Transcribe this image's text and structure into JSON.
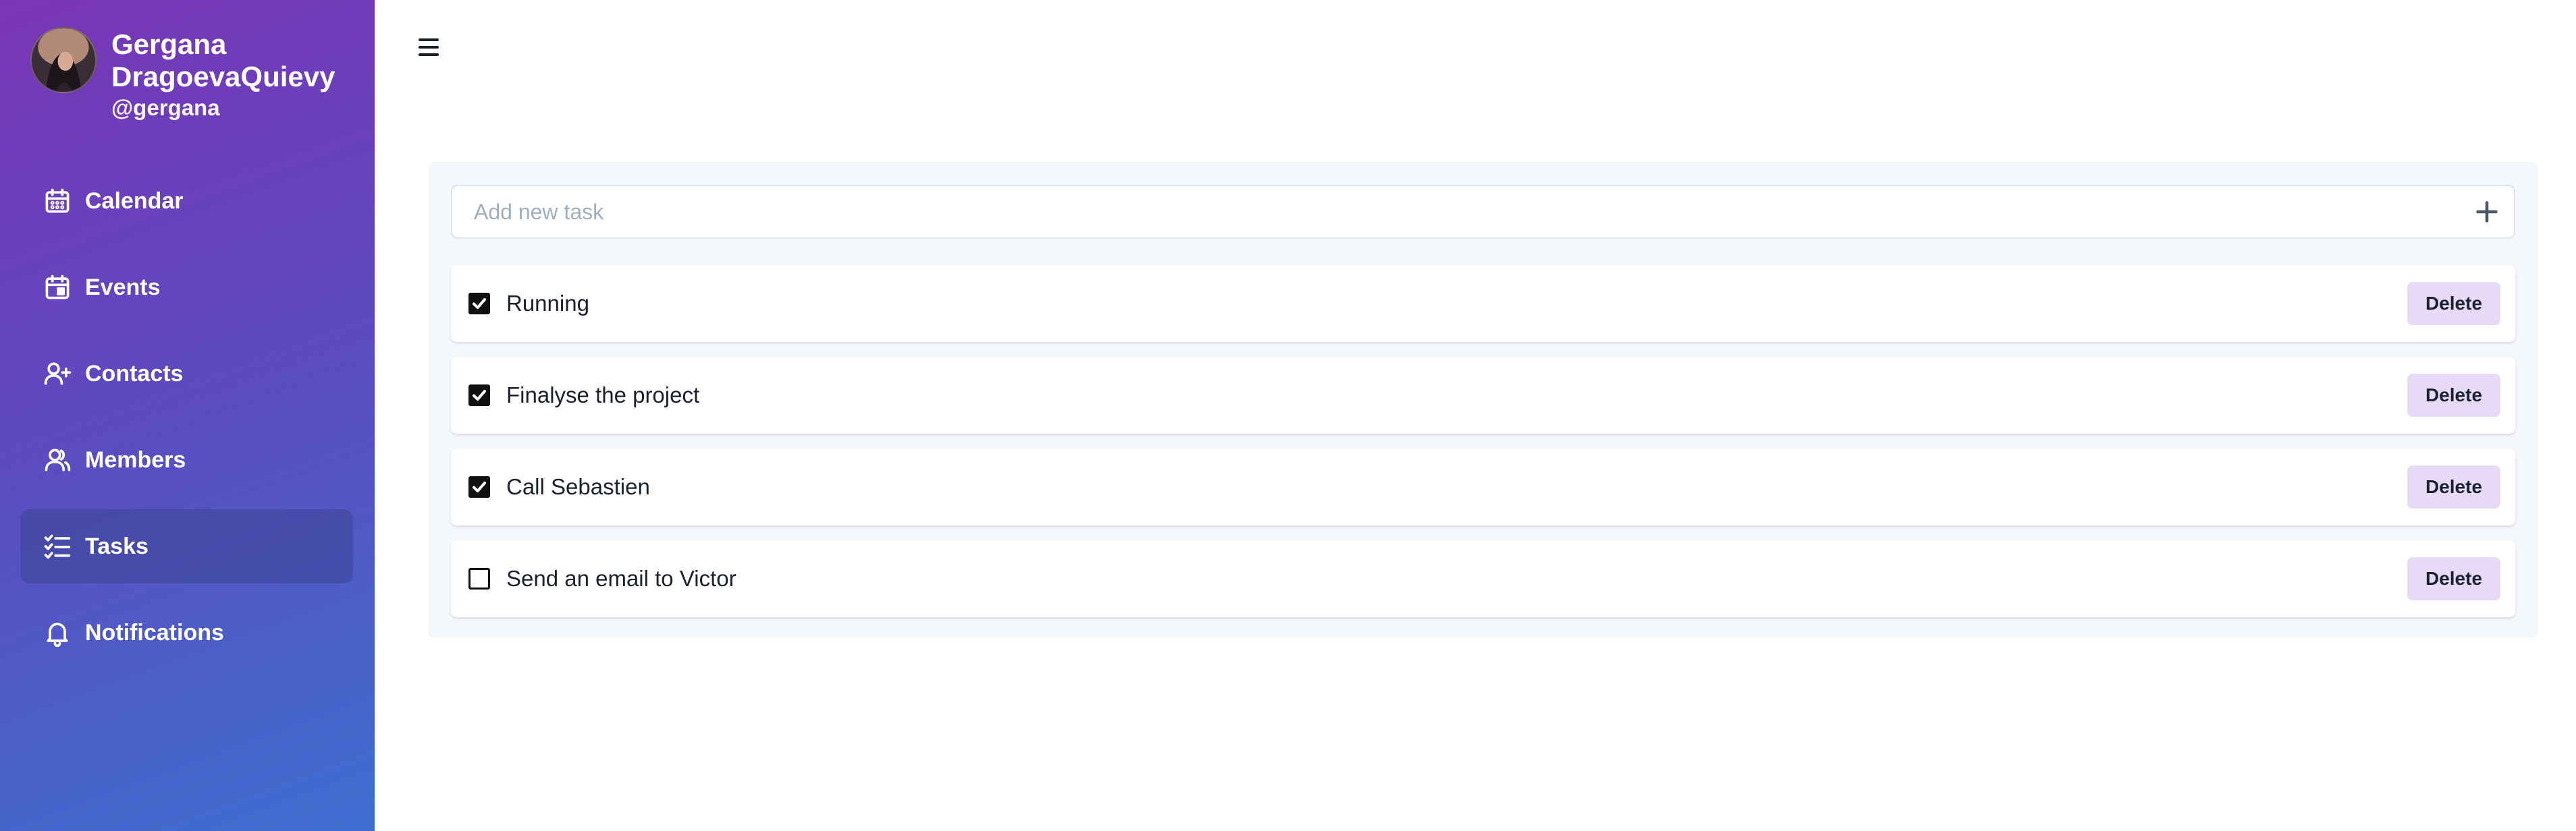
{
  "user": {
    "name": "Gergana DragoevaQuievy",
    "handle": "@gergana"
  },
  "nav": {
    "items": [
      {
        "label": "Calendar",
        "icon": "calendar-icon"
      },
      {
        "label": "Events",
        "icon": "event-icon"
      },
      {
        "label": "Contacts",
        "icon": "user-plus-icon"
      },
      {
        "label": "Members",
        "icon": "users-icon"
      },
      {
        "label": "Tasks",
        "icon": "tasks-icon",
        "active": true
      },
      {
        "label": "Notifications",
        "icon": "bell-icon"
      }
    ]
  },
  "tasks": {
    "add_placeholder": "Add new task",
    "delete_label": "Delete",
    "items": [
      {
        "label": "Running",
        "done": true
      },
      {
        "label": "Finalyse the project",
        "done": true
      },
      {
        "label": "Call Sebastien",
        "done": true
      },
      {
        "label": "Send an email to Victor",
        "done": false
      }
    ]
  },
  "colors": {
    "sidebar_gradient_start": "#7a35b6",
    "sidebar_gradient_end": "#3e6fd0",
    "delete_button_bg": "#e6daf7",
    "panel_bg": "#f4f7fb"
  }
}
